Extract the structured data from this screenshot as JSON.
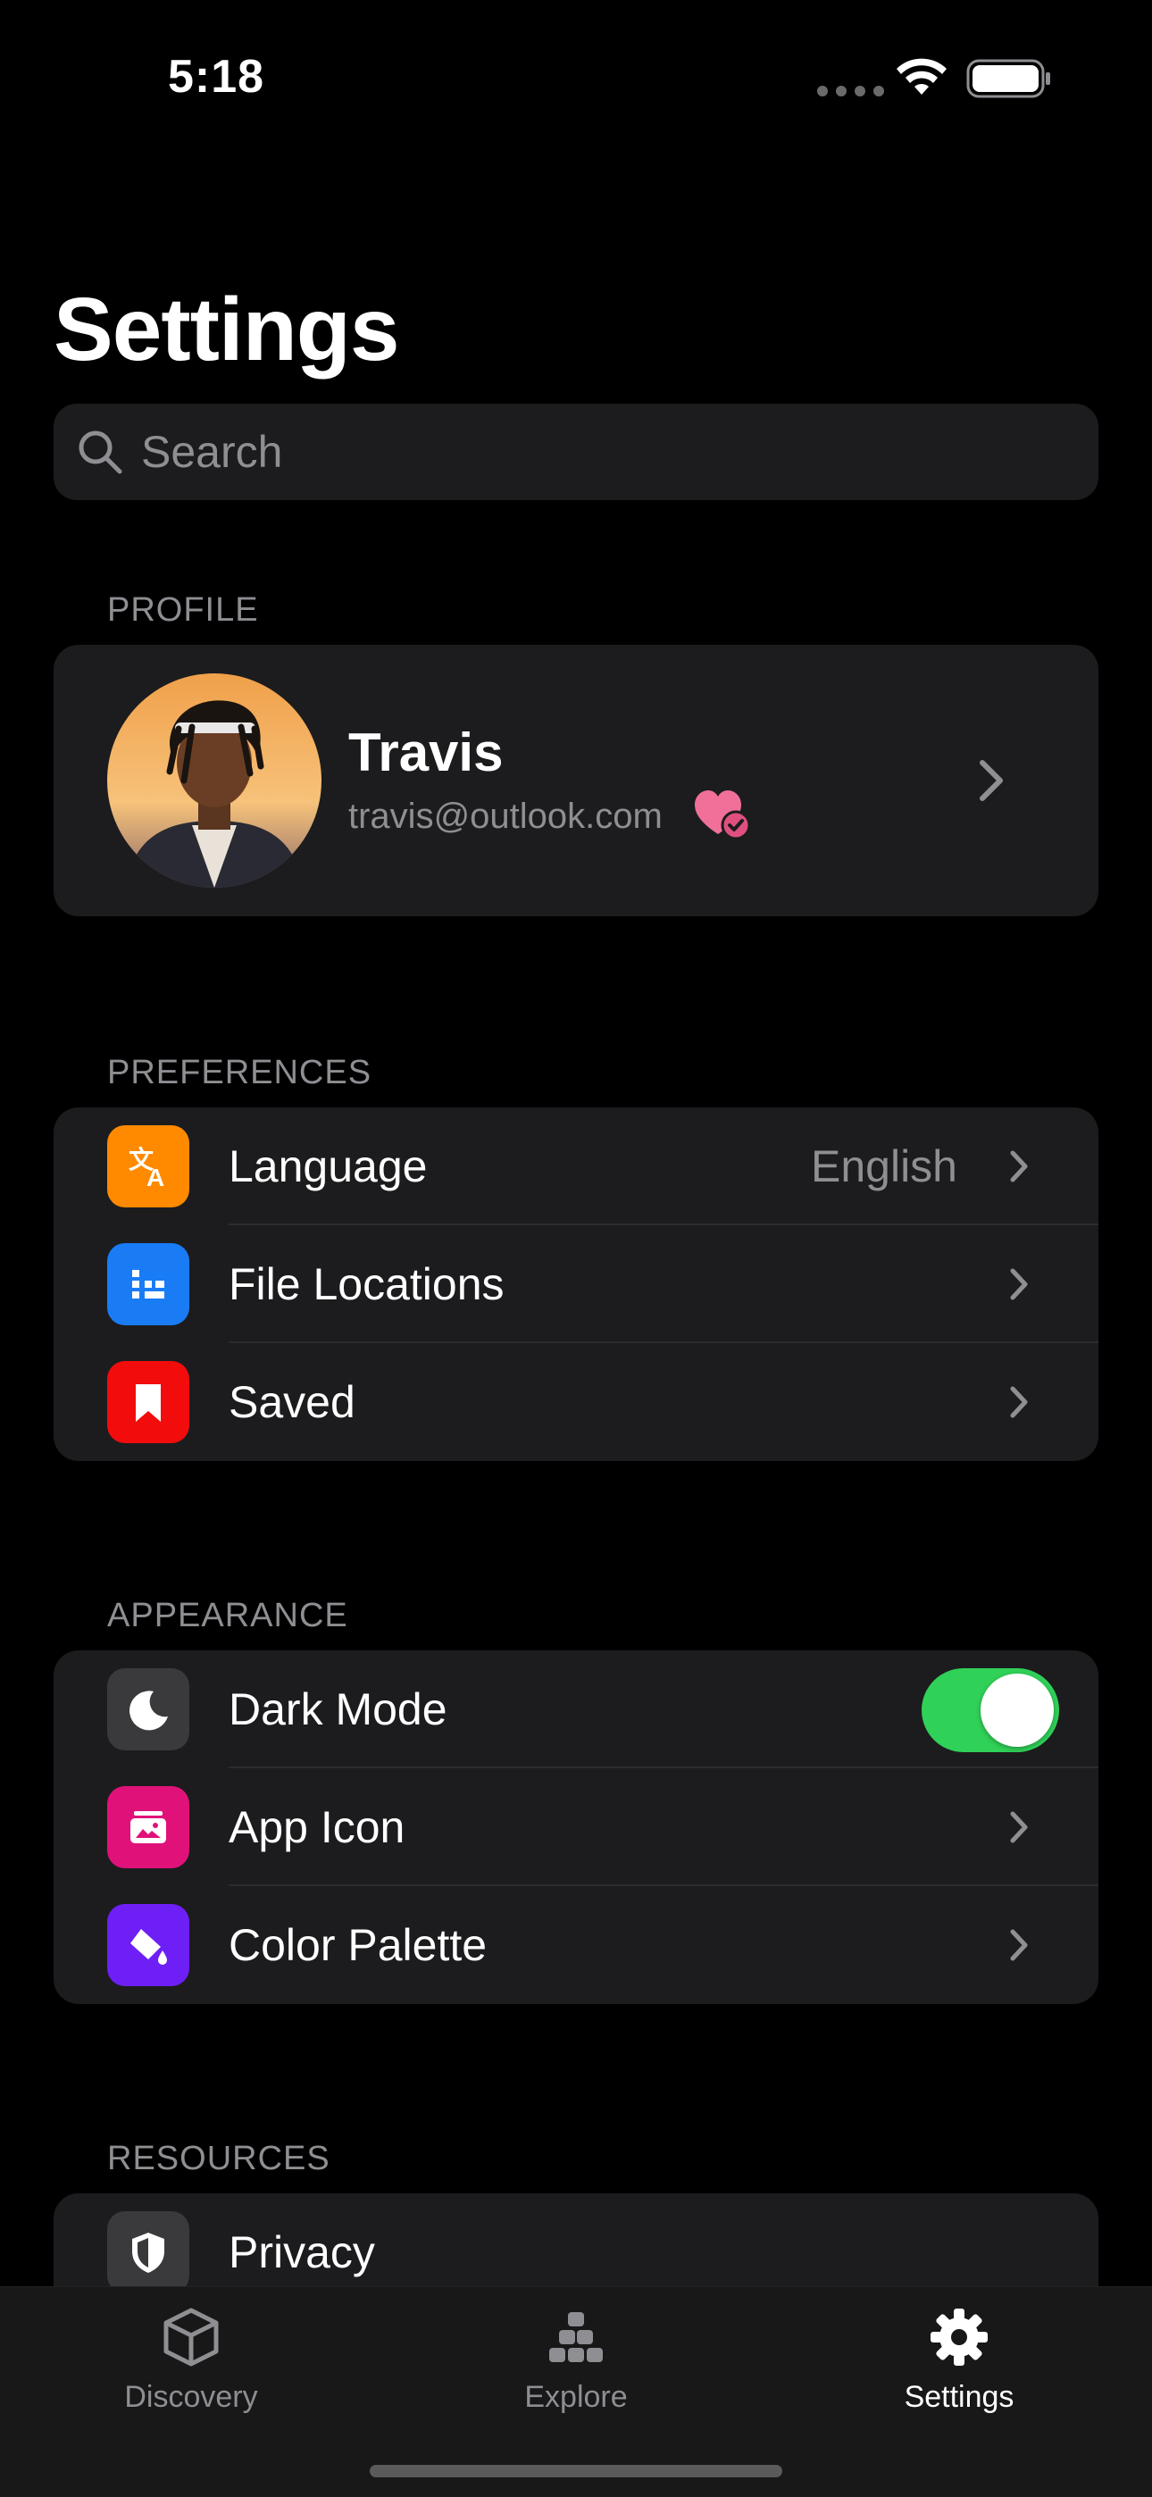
{
  "status_bar": {
    "time": "5:18"
  },
  "header": {
    "title": "Settings"
  },
  "search": {
    "placeholder": "Search"
  },
  "profile": {
    "section_label": "PROFILE",
    "name": "Travis",
    "email": "travis@outlook.com"
  },
  "preferences": {
    "section_label": "PREFERENCES",
    "items": [
      {
        "label": "Language",
        "value": "English",
        "icon": "translate-icon",
        "color": "#ff8a00"
      },
      {
        "label": "File Locations",
        "icon": "folder-tree-icon",
        "color": "#1a7cf5"
      },
      {
        "label": "Saved",
        "icon": "bookmark-icon",
        "color": "#f20c0c"
      }
    ]
  },
  "appearance": {
    "section_label": "APPEARANCE",
    "items": [
      {
        "label": "Dark Mode",
        "icon": "moon-icon",
        "color": "#3a3a3c",
        "toggle": true
      },
      {
        "label": "App Icon",
        "icon": "app-icon-icon",
        "color": "#e0127a"
      },
      {
        "label": "Color Palette",
        "icon": "paint-bucket-icon",
        "color": "#6e1ff5"
      }
    ]
  },
  "resources": {
    "section_label": "RESOURCES",
    "items": [
      {
        "label": "Privacy",
        "icon": "shield-icon",
        "color": "#3a3a3c"
      }
    ]
  },
  "tab_bar": {
    "tabs": [
      {
        "label": "Discovery",
        "icon": "cube-icon"
      },
      {
        "label": "Explore",
        "icon": "blocks-icon"
      },
      {
        "label": "Settings",
        "icon": "gear-icon",
        "active": true
      }
    ]
  },
  "colors": {
    "accent_toggle": "#30d158",
    "card_bg": "#1c1c1e",
    "secondary_text": "#8e8e93"
  }
}
